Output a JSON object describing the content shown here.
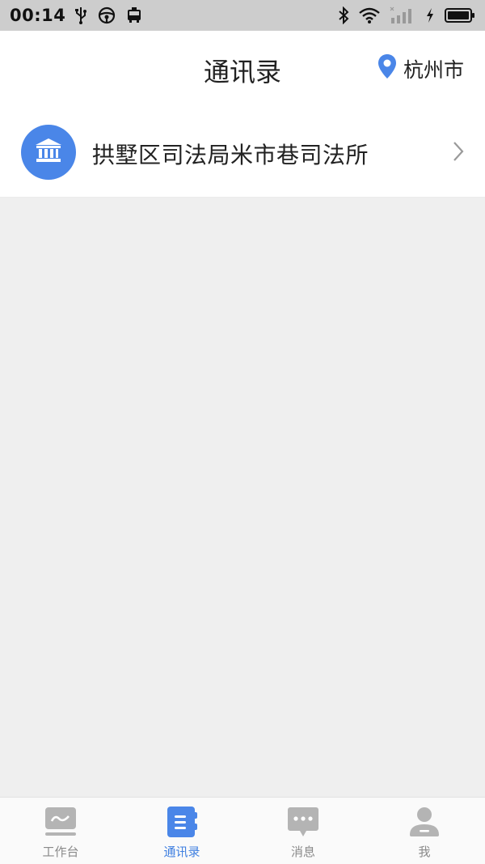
{
  "status_bar": {
    "time": "00:14",
    "left_icons": [
      "usb-icon",
      "steering-wheel-icon",
      "bus-icon"
    ],
    "right_icons": [
      "bluetooth-icon",
      "wifi-icon",
      "signal-icon",
      "charging-icon",
      "battery-icon"
    ]
  },
  "header": {
    "title": "通讯录",
    "location": "杭州市",
    "location_icon": "location-pin-icon"
  },
  "contacts": [
    {
      "name": "拱墅区司法局米市巷司法所",
      "icon": "institution-icon",
      "color": "#4a86e8"
    }
  ],
  "bottom_nav": {
    "active": "通讯录",
    "tabs": [
      {
        "label": "工作台",
        "icon": "workbench-icon"
      },
      {
        "label": "通讯录",
        "icon": "contacts-book-icon"
      },
      {
        "label": "消息",
        "icon": "message-icon"
      },
      {
        "label": "我",
        "icon": "profile-icon"
      }
    ]
  },
  "colors": {
    "accent": "#4a86e8",
    "nav_active": "#3f7fe0",
    "nav_inactive": "#b4b4b4",
    "background": "#efefef"
  }
}
